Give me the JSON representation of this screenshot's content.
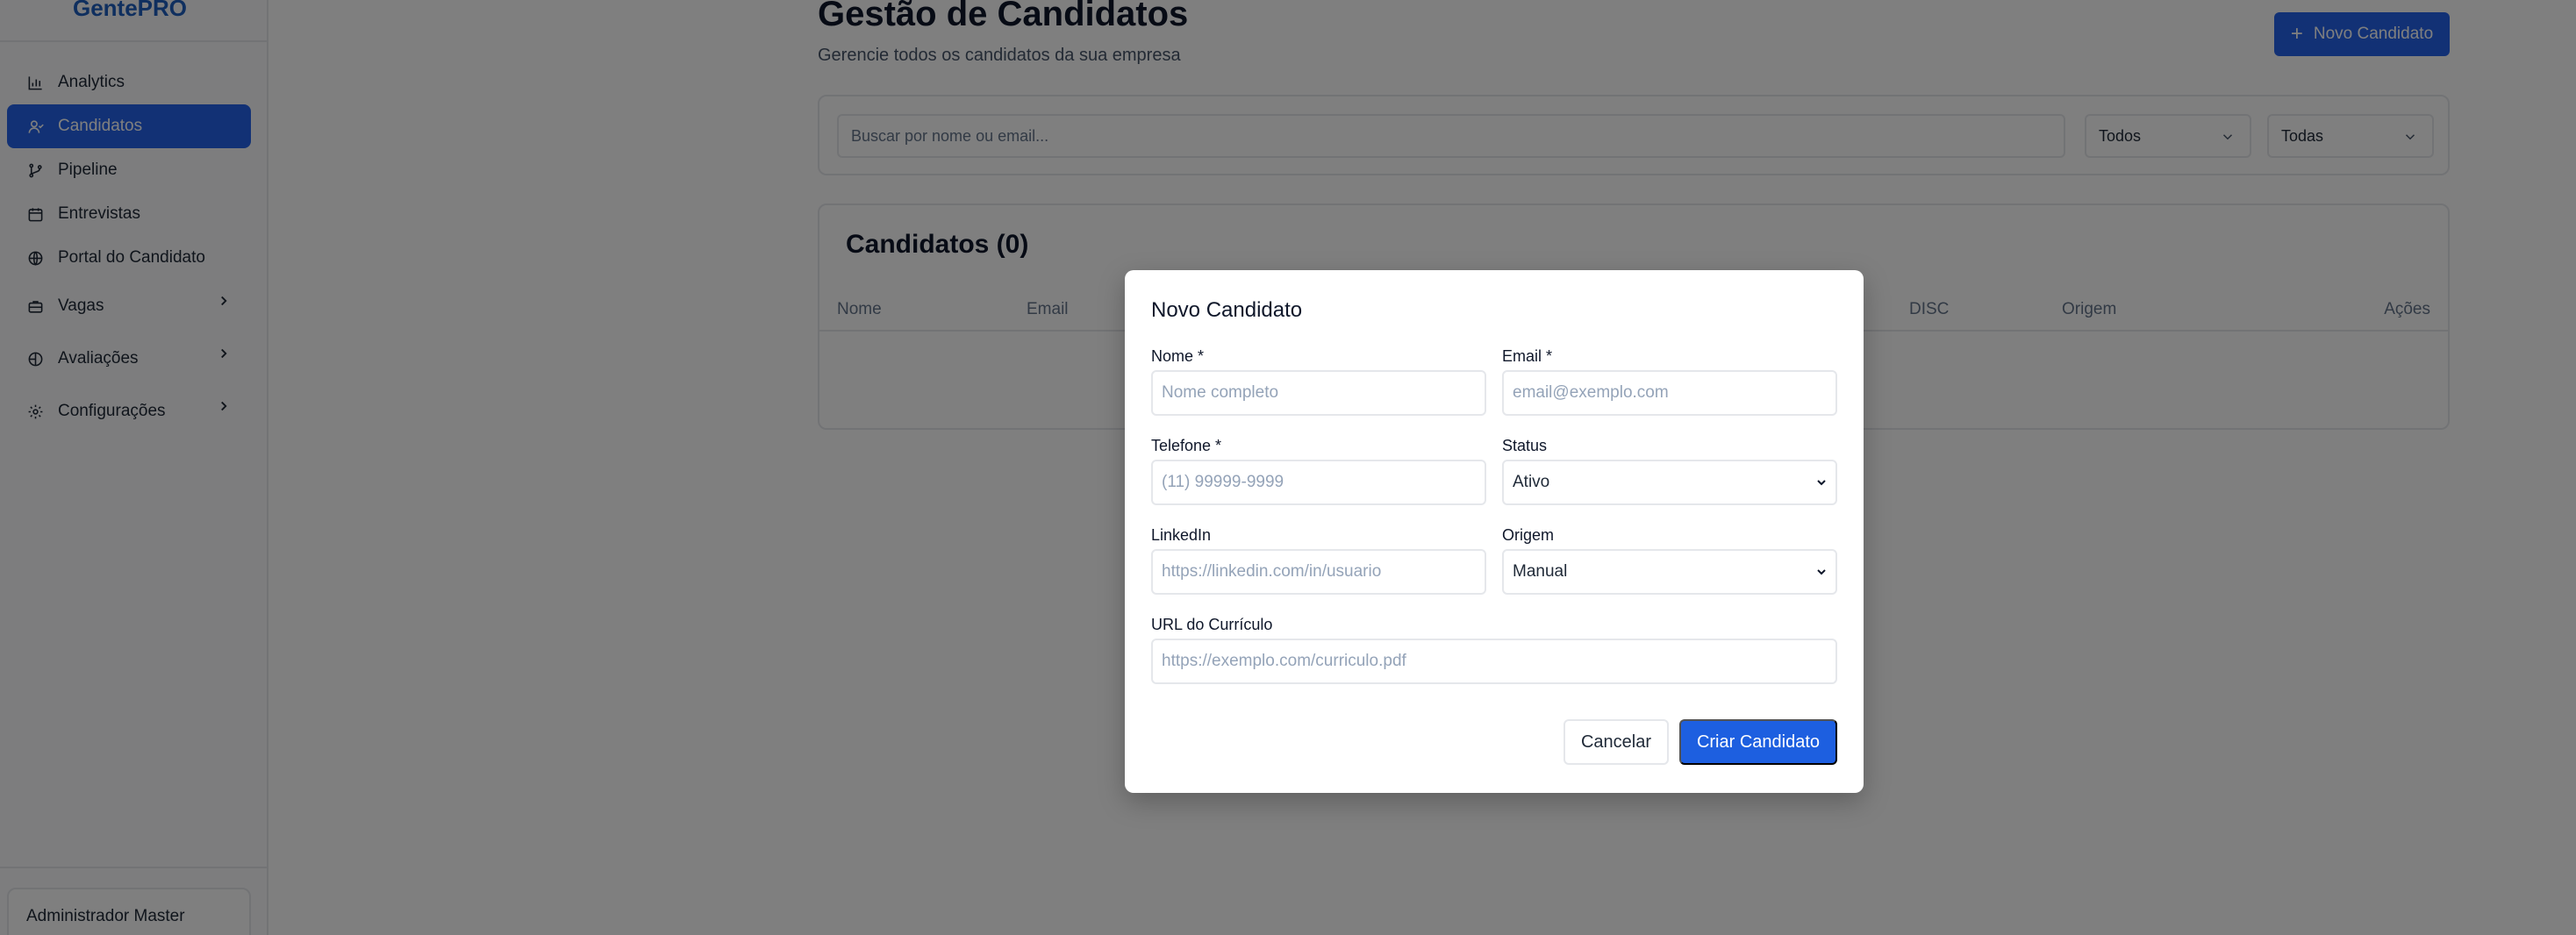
{
  "app": {
    "logo": "GentePRO"
  },
  "sidebar": {
    "items": [
      {
        "label": "Analytics",
        "icon": "bar-chart-icon"
      },
      {
        "label": "Candidatos",
        "icon": "user-icon",
        "active": true
      },
      {
        "label": "Pipeline",
        "icon": "git-branch-icon"
      },
      {
        "label": "Entrevistas",
        "icon": "calendar-icon"
      },
      {
        "label": "Portal do Candidato",
        "icon": "globe-icon"
      },
      {
        "label": "Vagas",
        "icon": "briefcase-icon",
        "expandable": true
      },
      {
        "label": "Avaliações",
        "icon": "target-icon",
        "expandable": true
      },
      {
        "label": "Configurações",
        "icon": "gear-icon",
        "expandable": true
      }
    ],
    "user_name": "Administrador Master"
  },
  "header": {
    "title": "Gestão de Candidatos",
    "subtitle": "Gerencie todos os candidatos da sua empresa",
    "new_button_label": "Novo Candidato"
  },
  "filters": {
    "search_placeholder": "Buscar por nome ou email...",
    "status_value": "Todos",
    "origin_value": "Todas"
  },
  "table": {
    "title": "Candidatos (0)",
    "columns": [
      "Nome",
      "Email",
      "DISC",
      "Origem",
      "Ações"
    ]
  },
  "modal": {
    "title": "Novo Candidato",
    "fields": {
      "nome": {
        "label": "Nome *",
        "placeholder": "Nome completo"
      },
      "email": {
        "label": "Email *",
        "placeholder": "email@exemplo.com"
      },
      "telefone": {
        "label": "Telefone *",
        "placeholder": "(11) 99999-9999"
      },
      "status": {
        "label": "Status",
        "value": "Ativo"
      },
      "linkedin": {
        "label": "LinkedIn",
        "placeholder": "https://linkedin.com/in/usuario"
      },
      "origem": {
        "label": "Origem",
        "value": "Manual"
      },
      "curriculo": {
        "label": "URL do Currículo",
        "placeholder": "https://exemplo.com/curriculo.pdf"
      }
    },
    "cancel_label": "Cancelar",
    "create_label": "Criar Candidato"
  },
  "colors": {
    "primary": "#2563eb",
    "overlay": "rgba(0,0,0,0.5)"
  }
}
